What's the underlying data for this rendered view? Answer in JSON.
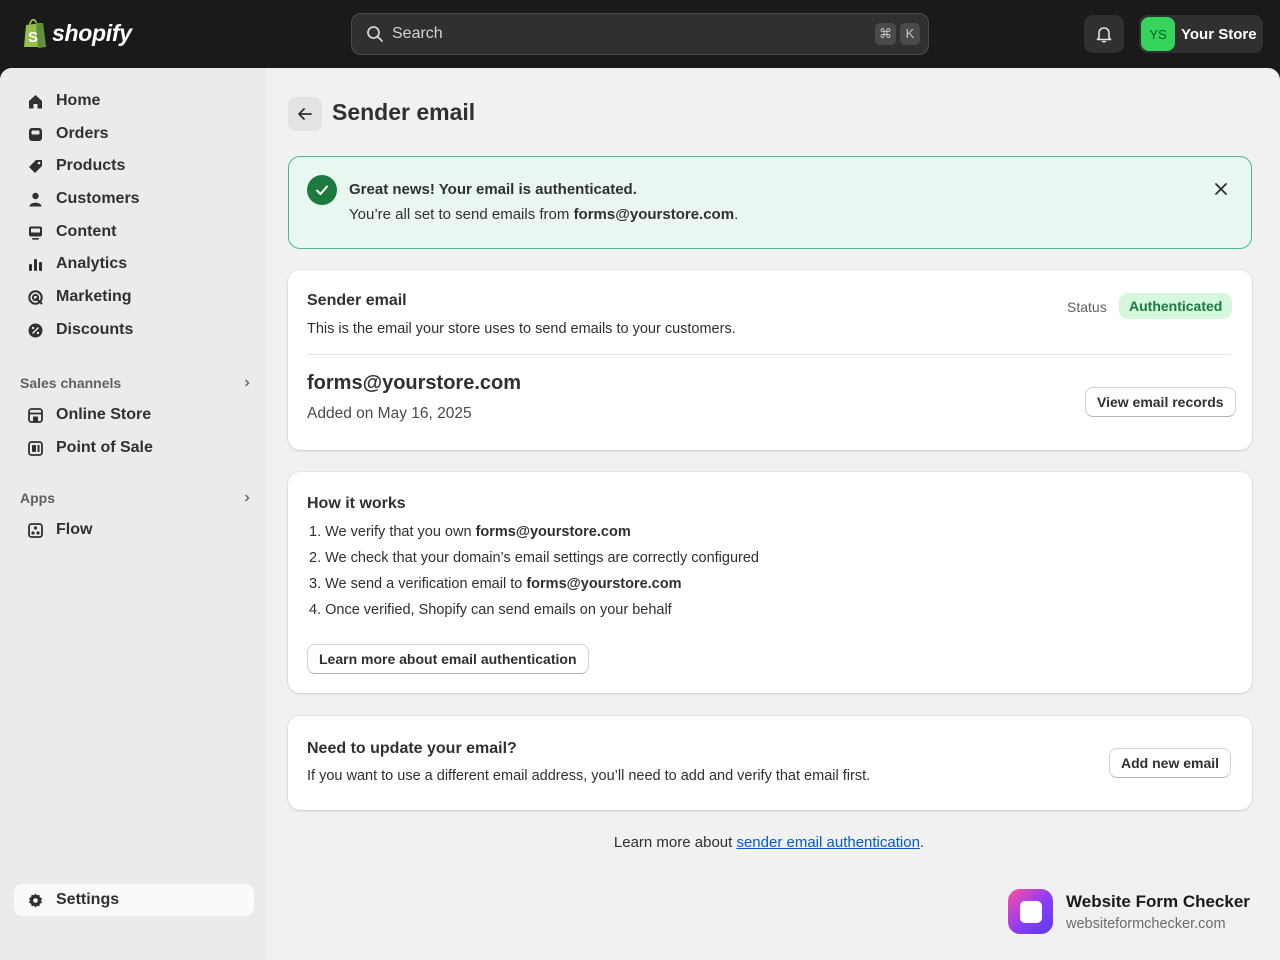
{
  "topbar": {
    "logo_text": "shopify",
    "search_placeholder": "Search",
    "shortcut_keys": [
      "⌘",
      "K"
    ],
    "store_initials": "YS",
    "store_name": "Your Store"
  },
  "sidebar": {
    "items": [
      {
        "label": "Home",
        "icon": "home-icon"
      },
      {
        "label": "Orders",
        "icon": "orders-icon"
      },
      {
        "label": "Products",
        "icon": "tag-icon"
      },
      {
        "label": "Customers",
        "icon": "person-icon"
      },
      {
        "label": "Content",
        "icon": "content-icon"
      },
      {
        "label": "Analytics",
        "icon": "bar-chart-icon"
      },
      {
        "label": "Marketing",
        "icon": "target-icon"
      },
      {
        "label": "Discounts",
        "icon": "discount-icon"
      }
    ],
    "sales_channels_label": "Sales channels",
    "sales_channels": [
      {
        "label": "Online Store",
        "icon": "storefront-icon"
      },
      {
        "label": "Point of Sale",
        "icon": "pos-icon"
      }
    ],
    "apps_label": "Apps",
    "apps": [
      {
        "label": "Flow",
        "icon": "flow-icon"
      }
    ],
    "settings_label": "Settings"
  },
  "page": {
    "title": "Sender email"
  },
  "banner": {
    "heading": "Great news! Your email is authenticated.",
    "text_prefix": "You’re all set to send emails from ",
    "text_email": "forms@yourstore.com",
    "text_suffix": "."
  },
  "sender_card": {
    "heading": "Sender email",
    "description": "This is the email your store uses to send emails to your customers.",
    "status_label": "Status",
    "status_value": "Authenticated",
    "email": "forms@yourstore.com",
    "added": "Added on May 16, 2025",
    "view_button": "View email records"
  },
  "how_card": {
    "heading": "How it works",
    "steps": [
      {
        "num": "1.",
        "text": "We verify that you own ",
        "bold": "forms@yourstore.com"
      },
      {
        "num": "2.",
        "text": "We check that your domain’s email settings are correctly configured",
        "bold": ""
      },
      {
        "num": "3.",
        "text": "We send a verification email to ",
        "bold": "forms@yourstore.com"
      },
      {
        "num": "4.",
        "text": "Once verified, Shopify can send emails on your behalf",
        "bold": ""
      }
    ],
    "learn_button": "Learn more about email authentication"
  },
  "update_card": {
    "heading": "Need to update your email?",
    "description": "If you want to use a different email address, you’ll need to add and verify that email first.",
    "add_button": "Add new email"
  },
  "footer": {
    "prefix": "Learn more about ",
    "link": "sender email authentication",
    "suffix": "."
  },
  "watermark": {
    "name": "Website Form Checker",
    "url": "websiteformchecker.com"
  },
  "colors": {
    "topbar": "#1a1a1a",
    "success": "#1c7a3e",
    "badge_bg": "#d4f7dd",
    "link": "#005bd3"
  }
}
